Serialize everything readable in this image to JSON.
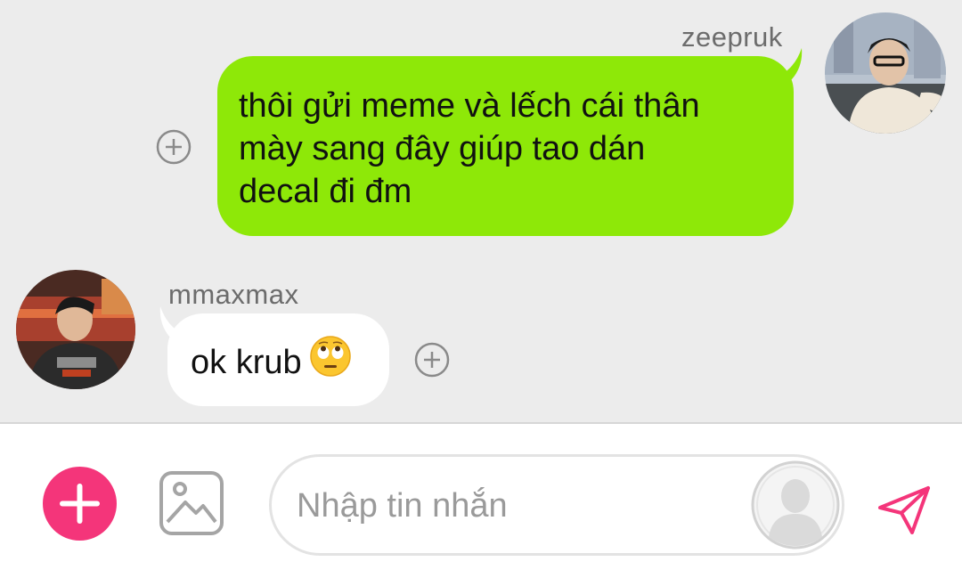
{
  "messages": [
    {
      "direction": "outgoing",
      "sender": "zeepruk",
      "text_lines": [
        "thôi gửi meme và lếch cái thân",
        "mày sang đây giúp tao dán",
        "decal đi đm"
      ],
      "bubble_color": "#8ee808"
    },
    {
      "direction": "incoming",
      "sender": "mmaxmax",
      "text": "ok krub",
      "emoji": "rolling-eyes-emoji",
      "bubble_color": "#ffffff"
    }
  ],
  "composer": {
    "placeholder": "Nhập tin nhắn",
    "value": ""
  },
  "colors": {
    "accent": "#f4357a",
    "chat_background": "#ececec",
    "sender_name": "#6c6c6c"
  },
  "icons": {
    "add": "plus-icon",
    "image": "image-icon",
    "sticker": "person-silhouette-icon",
    "send": "paper-plane-icon",
    "react": "add-reaction-icon"
  }
}
